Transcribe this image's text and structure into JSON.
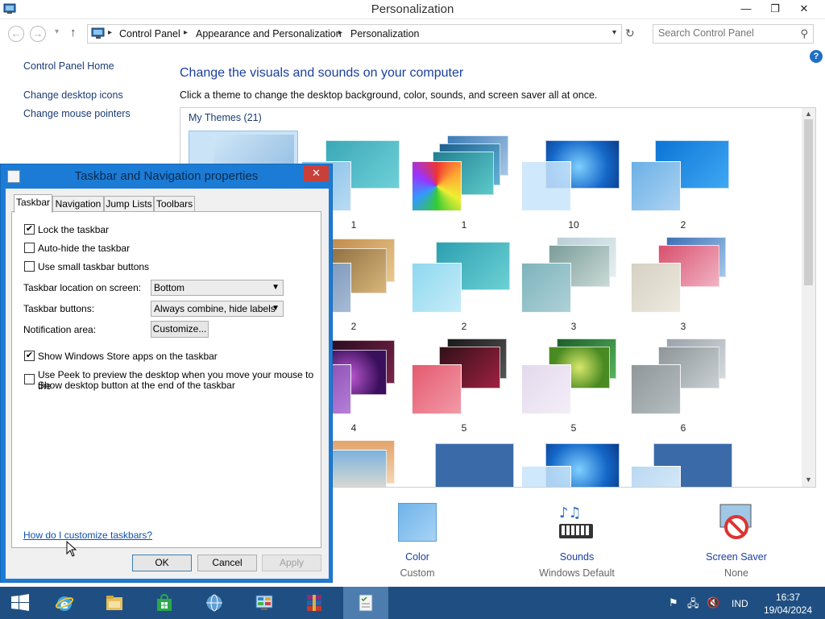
{
  "window": {
    "title": "Personalization",
    "controls": {
      "minimize": "—",
      "restore": "❐",
      "close": "✕"
    }
  },
  "address": {
    "crumbs": [
      "Control Panel",
      "Appearance and Personalization",
      "Personalization"
    ],
    "search_placeholder": "Search Control Panel"
  },
  "sidebar": {
    "items": [
      "Control Panel Home",
      "Change desktop icons",
      "Change mouse pointers"
    ]
  },
  "main": {
    "heading": "Change the visuals and sounds on your computer",
    "subtext": "Click a theme to change the desktop background, color, sounds, and screen saver all at once.",
    "themes_label": "My Themes (21)",
    "themes": [
      {
        "label": ""
      },
      {
        "label": "1"
      },
      {
        "label": "1"
      },
      {
        "label": "10"
      },
      {
        "label": "2"
      },
      {
        "label": "2"
      },
      {
        "label": "2"
      },
      {
        "label": "3"
      },
      {
        "label": "3"
      },
      {
        "label": "4"
      },
      {
        "label": "5"
      },
      {
        "label": "5"
      },
      {
        "label": "6"
      }
    ],
    "bottom": [
      {
        "name": "Color",
        "sub": "Custom"
      },
      {
        "name": "Sounds",
        "sub": "Windows Default"
      },
      {
        "name": "Screen Saver",
        "sub": "None"
      }
    ]
  },
  "dialog": {
    "title": "Taskbar and Navigation properties",
    "tabs": [
      "Taskbar",
      "Navigation",
      "Jump Lists",
      "Toolbars"
    ],
    "options": {
      "lock_taskbar": "Lock the taskbar",
      "auto_hide": "Auto-hide the taskbar",
      "small_buttons": "Use small taskbar buttons",
      "store_apps": "Show Windows Store apps on the taskbar",
      "peek_line1": "Use Peek to preview the desktop when you move your mouse to the",
      "peek_line2": "Show desktop button at the end of the taskbar"
    },
    "checked": {
      "lock_taskbar": "✔",
      "auto_hide": "",
      "small_buttons": "",
      "store_apps": "✔",
      "peek": ""
    },
    "location_label": "Taskbar location on screen:",
    "location_value": "Bottom",
    "buttons_label": "Taskbar buttons:",
    "buttons_value": "Always combine, hide labels",
    "notification_label": "Notification area:",
    "customize": "Customize...",
    "help_link": "How do I customize taskbars?",
    "ok": "OK",
    "cancel": "Cancel",
    "apply": "Apply"
  },
  "taskbar": {
    "language": "IND",
    "time": "16:37",
    "date": "19/04/2024"
  },
  "colors": {
    "accent": "#1c7cd5",
    "taskbar": "#1f4f82",
    "link": "#1a3fa0",
    "close_red": "#c9403a"
  }
}
